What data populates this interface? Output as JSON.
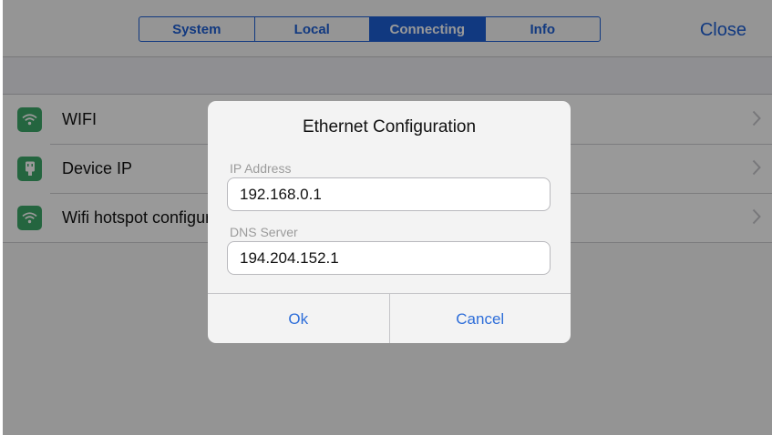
{
  "tabs": [
    {
      "label": "System",
      "active": false
    },
    {
      "label": "Local",
      "active": false
    },
    {
      "label": "Connecting",
      "active": true
    },
    {
      "label": "Info",
      "active": false
    }
  ],
  "close_label": "Close",
  "list_items": [
    {
      "label": "WIFI",
      "icon": "wifi-icon"
    },
    {
      "label": "Device IP",
      "icon": "device-icon"
    },
    {
      "label": "Wifi hotspot configuration",
      "icon": "wifi-icon"
    }
  ],
  "dialog": {
    "title": "Ethernet Configuration",
    "ip_label": "IP Address",
    "ip_value": "192.168.0.1",
    "dns_label": "DNS Server",
    "dns_value": "194.204.152.1",
    "ok_label": "Ok",
    "cancel_label": "Cancel"
  },
  "colors": {
    "accent": "#1d5fd6",
    "icon_green": "#3da86a"
  }
}
